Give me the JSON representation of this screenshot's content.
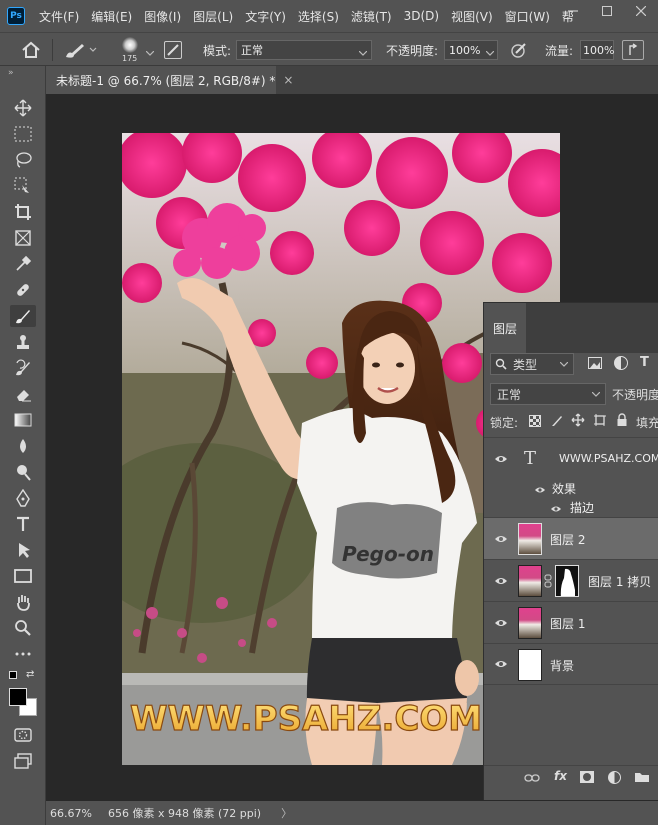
{
  "menubar": {
    "items": [
      "文件(F)",
      "编辑(E)",
      "图像(I)",
      "图层(L)",
      "文字(Y)",
      "选择(S)",
      "滤镜(T)",
      "3D(D)",
      "视图(V)",
      "窗口(W)",
      "帮"
    ]
  },
  "options": {
    "brush_size": "175",
    "mode_label": "模式:",
    "mode_value": "正常",
    "opacity_label": "不透明度:",
    "opacity_value": "100%",
    "flow_label": "流量:",
    "flow_value": "100%"
  },
  "document": {
    "tab_title": "未标题-1 @ 66.7% (图层 2, RGB/8#) *",
    "close": "×"
  },
  "photo": {
    "watermark": "WWW.PSAHZ.COM",
    "shirt_text": "Pego-on"
  },
  "status": {
    "zoom": "66.67%",
    "info": "656 像素 x 948 像素 (72 ppi)",
    "arrow": "〉"
  },
  "layers_panel": {
    "tab": "图层",
    "filter_label": "类型",
    "blend_mode": "正常",
    "opacity_label": "不透明度",
    "lock_label": "锁定:",
    "fill_label": "填充",
    "layers": [
      {
        "name": "WWW.PSAHZ.COM",
        "type": "text"
      },
      {
        "name": "效果",
        "type": "effects"
      },
      {
        "name": "描边",
        "type": "effect"
      },
      {
        "name": "图层 2",
        "type": "image"
      },
      {
        "name": "图层 1 拷贝",
        "type": "image-mask"
      },
      {
        "name": "图层 1",
        "type": "image"
      },
      {
        "name": "背景",
        "type": "background"
      }
    ],
    "footer_fx": "fx"
  },
  "colors": {
    "accent": "#31a8ff",
    "watermark_fill": "#f2c14e"
  }
}
